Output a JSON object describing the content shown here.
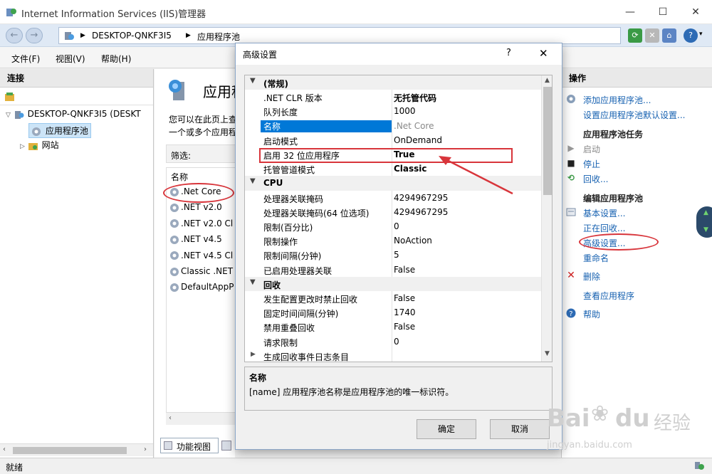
{
  "window": {
    "title": "Internet Information Services (IIS)管理器",
    "controls": [
      "—",
      "☐",
      "✕"
    ]
  },
  "addressbar": {
    "breadcrumb": [
      "DESKTOP-QNKF3I5",
      "应用程序池"
    ]
  },
  "menu": [
    "文件(F)",
    "视图(V)",
    "帮助(H)"
  ],
  "connections": {
    "header": "连接",
    "tree": [
      {
        "label": "DESKTOP-QNKF3I5 (DESKT"
      },
      {
        "label": "应用程序池"
      },
      {
        "label": "网站"
      }
    ]
  },
  "middle": {
    "title": "应用程",
    "desc1": "您可以在此页上查",
    "desc2": "一个或多个应用程",
    "filter_label": "筛选:",
    "column": "名称",
    "pools": [
      ".Net Core",
      ".NET v2.0",
      ".NET v2.0 Cl",
      ".NET v4.5",
      ".NET v4.5 Cl",
      "Classic .NET",
      "DefaultAppP"
    ],
    "view_tab": "功能视图"
  },
  "actions": {
    "header": "操作",
    "add_pool": "添加应用程序池...",
    "set_defaults": "设置应用程序池默认设置...",
    "task_header": "应用程序池任务",
    "start": "启动",
    "stop": "停止",
    "recycle": "回收...",
    "edit_header": "编辑应用程序池",
    "basic": "基本设置...",
    "recycling": "正在回收...",
    "advanced": "高级设置...",
    "rename": "重命名",
    "delete": "删除",
    "view_apps": "查看应用程序",
    "help": "帮助"
  },
  "status": "就绪",
  "dialog": {
    "title": "高级设置",
    "help": "?",
    "close": "✕",
    "rows": [
      {
        "type": "cat",
        "name": "(常规)"
      },
      {
        "type": "prop",
        "name": ".NET CLR 版本",
        "value": "无托管代码",
        "bold": true
      },
      {
        "type": "prop",
        "name": "队列长度",
        "value": "1000"
      },
      {
        "type": "prop",
        "name": "名称",
        "value": ".Net Core",
        "selected": true
      },
      {
        "type": "prop",
        "name": "启动模式",
        "value": "OnDemand"
      },
      {
        "type": "prop",
        "name": "启用 32 位应用程序",
        "value": "True",
        "bold": true
      },
      {
        "type": "prop",
        "name": "托管管道模式",
        "value": "Classic",
        "bold": true
      },
      {
        "type": "cat",
        "name": "CPU"
      },
      {
        "type": "prop",
        "name": "处理器关联掩码",
        "value": "4294967295"
      },
      {
        "type": "prop",
        "name": "处理器关联掩码(64 位选项)",
        "value": "4294967295"
      },
      {
        "type": "prop",
        "name": "限制(百分比)",
        "value": "0"
      },
      {
        "type": "prop",
        "name": "限制操作",
        "value": "NoAction"
      },
      {
        "type": "prop",
        "name": "限制间隔(分钟)",
        "value": "5"
      },
      {
        "type": "prop",
        "name": "已启用处理器关联",
        "value": "False"
      },
      {
        "type": "cat",
        "name": "回收"
      },
      {
        "type": "prop",
        "name": "发生配置更改时禁止回收",
        "value": "False"
      },
      {
        "type": "prop",
        "name": "固定时间间隔(分钟)",
        "value": "1740"
      },
      {
        "type": "prop",
        "name": "禁用重叠回收",
        "value": "False"
      },
      {
        "type": "prop",
        "name": "请求限制",
        "value": "0"
      },
      {
        "type": "sub",
        "name": "生成回收事件日志条目",
        "value": ""
      }
    ],
    "desc_title": "名称",
    "desc_text": "[name] 应用程序池名称是应用程序池的唯一标识符。",
    "ok": "确定",
    "cancel": "取消"
  },
  "watermark": {
    "brand": "Bai",
    "brand2": "du",
    "cn": "经验",
    "url": "jingyan.baidu.com"
  },
  "colors": {
    "annotation": "#d8353b",
    "selection": "#0078d7",
    "link": "#1560b0"
  }
}
